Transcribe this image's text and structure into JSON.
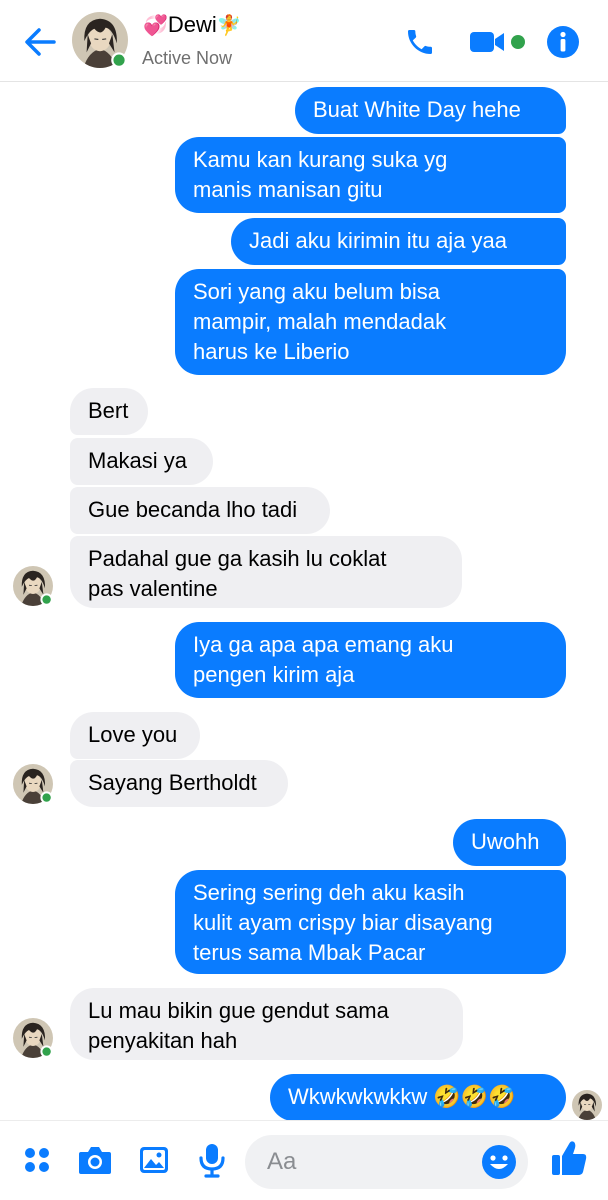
{
  "header": {
    "name_prefix_emoji": "💞",
    "name": "Dewi",
    "name_suffix_emoji": "🧚",
    "status": "Active Now"
  },
  "messages": [
    {
      "side": "out",
      "text": "Buat White Day hehe"
    },
    {
      "side": "out",
      "text": "Kamu kan kurang suka yg\nmanis manisan gitu"
    },
    {
      "side": "out",
      "text": "Jadi aku kirimin itu aja yaa"
    },
    {
      "side": "out",
      "text": "Sori yang aku belum bisa\nmampir, malah mendadak\nharus ke Liberio"
    },
    {
      "side": "in",
      "text": "Bert"
    },
    {
      "side": "in",
      "text": "Makasi ya"
    },
    {
      "side": "in",
      "text": "Gue becanda lho tadi"
    },
    {
      "side": "in",
      "text": "Padahal gue ga kasih lu coklat\npas valentine"
    },
    {
      "side": "out",
      "text": "Iya ga apa apa emang aku\npengen kirim aja"
    },
    {
      "side": "in",
      "text": "Love you"
    },
    {
      "side": "in",
      "text": "Sayang Bertholdt"
    },
    {
      "side": "out",
      "text": "Uwohh"
    },
    {
      "side": "out",
      "text": "Sering sering deh aku kasih\nkulit ayam crispy biar disayang\nterus sama Mbak Pacar"
    },
    {
      "side": "in",
      "text": "Lu mau bikin gue gendut sama\npenyakitan hah"
    },
    {
      "side": "out",
      "text": "Wkwkwkwkkw 🤣🤣🤣"
    }
  ],
  "composer": {
    "placeholder": "Aa"
  },
  "colors": {
    "accent": "#0a7cff",
    "incoming_bubble": "#efeff2",
    "online_dot": "#31a24c"
  },
  "icons": {
    "back": "arrow-left-icon",
    "call": "phone-icon",
    "video": "video-camera-icon",
    "info": "info-icon",
    "menu": "four-dots-icon",
    "camera": "camera-icon",
    "gallery": "image-icon",
    "mic": "microphone-icon",
    "emoji": "smiley-icon",
    "like": "thumbs-up-icon"
  }
}
